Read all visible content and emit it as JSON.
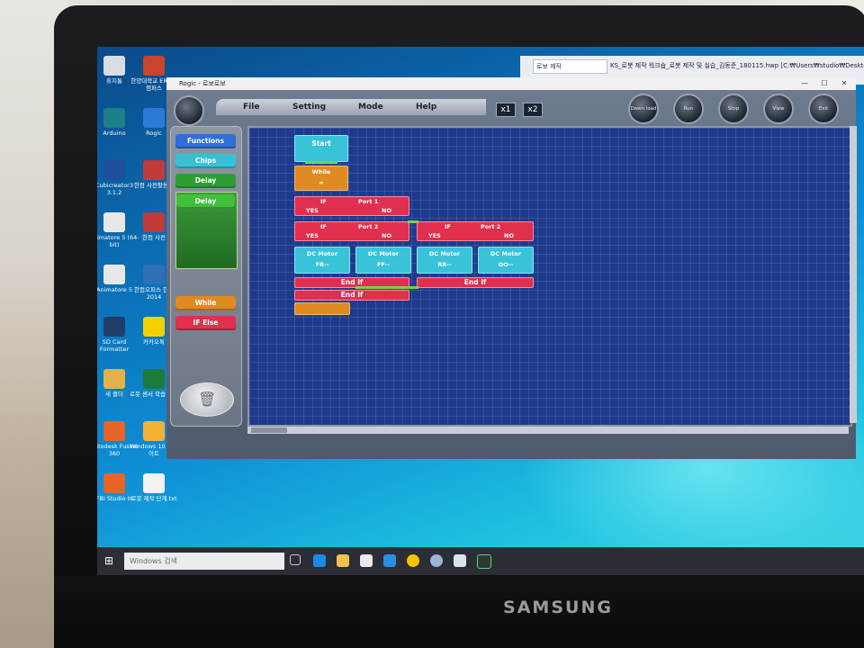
{
  "desktop": {
    "icons": [
      {
        "label": "휴지통",
        "icon": "recycle-bin-icon"
      },
      {
        "label": "한양대학교 ERICA 캠퍼스",
        "icon": "erica-icon"
      },
      {
        "label": "Arduino",
        "icon": "arduino-icon"
      },
      {
        "label": "Rogic",
        "icon": "rogic-icon"
      },
      {
        "label": "Cubicreator3 3.1.2",
        "icon": "cubicreator-icon"
      },
      {
        "label": "한컴 사전활용...",
        "icon": "hancom-icon"
      },
      {
        "label": "Animatore 5 (64-bit)",
        "icon": "animatore-icon"
      },
      {
        "label": "한컴 사전",
        "icon": "hancom-dict-icon"
      },
      {
        "label": "Animatore 5",
        "icon": "animatore2-icon"
      },
      {
        "label": "한컴오피스 한글 2014",
        "icon": "hwp-icon"
      },
      {
        "label": "SD Card Formatter",
        "icon": "sdcard-icon"
      },
      {
        "label": "카카오톡",
        "icon": "kakaotalk-icon"
      },
      {
        "label": "새 폴더",
        "icon": "folder-icon"
      },
      {
        "label": "로봇 센서 학습 교안",
        "icon": "excel-icon"
      },
      {
        "label": "Autodesk Fusion 360",
        "icon": "fusion-icon"
      },
      {
        "label": "Windows 10 업데이트",
        "icon": "windows-update-icon"
      },
      {
        "label": "FBI Studio III",
        "icon": "fbi-icon"
      },
      {
        "label": "로봇 제작 단계.txt",
        "icon": "text-file-icon"
      }
    ]
  },
  "bg_window": {
    "tab": "로보 제작",
    "title": "KS_로봇 제작 워크숍_로봇 제작 및 실습_김동준_180115.hwp [C:₩Users₩studio₩Desktop..."
  },
  "rogic": {
    "title": "Rogic - 로보로보",
    "menu": [
      "File",
      "Setting",
      "Mode",
      "Help"
    ],
    "zoom": [
      "x1",
      "x2"
    ],
    "toolbar": [
      "Down load",
      "Run",
      "Stop",
      "View",
      "Exit"
    ],
    "palette": {
      "functions": "Functions",
      "chips": "Chips",
      "delay": "Delay",
      "delay_item": "Delay",
      "while": "While",
      "if_else": "IF Else"
    },
    "blocks": {
      "start": "Start",
      "while": "While",
      "while_value": "∞",
      "if1": {
        "label": "IF",
        "port": "Port 1",
        "yes": "YES",
        "no": "NO"
      },
      "if2": {
        "label": "IF",
        "port": "Port 2",
        "yes": "YES",
        "no": "NO"
      },
      "if3": {
        "label": "IF",
        "port": "Port 2",
        "yes": "YES",
        "no": "NO"
      },
      "motors": [
        {
          "label": "DC Motor",
          "value": "FR--"
        },
        {
          "label": "DC Motor",
          "value": "FF--"
        },
        {
          "label": "DC Motor",
          "value": "RR--"
        },
        {
          "label": "DC Motor",
          "value": "OO--"
        }
      ],
      "endif1": "End If",
      "endif2": "End If",
      "endif3": "End If"
    }
  },
  "taskbar": {
    "search_placeholder": "Windows 검색"
  },
  "brand": "SAMSUNG",
  "colors": {
    "palette_blue": "#2f6fd8",
    "palette_cyan": "#37c1d6",
    "palette_green": "#2e9e32",
    "palette_orange": "#e08a24",
    "palette_red": "#e0304e"
  }
}
